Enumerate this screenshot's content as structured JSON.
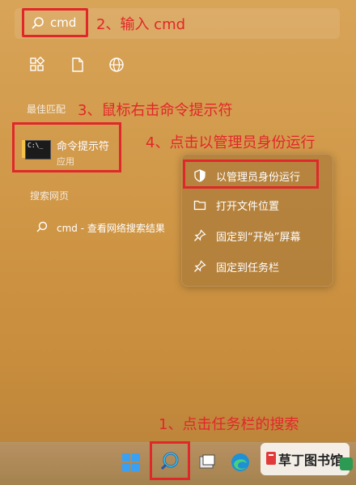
{
  "search": {
    "query": "cmd"
  },
  "annotations": {
    "step1": "1、点击任务栏的搜索",
    "step2": "2、输入 cmd",
    "step3": "3、鼠标右击命令提示符",
    "step4": "4、点击以管理员身份运行"
  },
  "sections": {
    "best_match": "最佳匹配",
    "web_search": "搜索网页"
  },
  "best_match": {
    "name": "命令提示符",
    "type": "应用"
  },
  "web_result": {
    "text": "cmd - 查看网络搜索结果"
  },
  "context_menu": {
    "items": [
      {
        "label": "以管理员身份运行",
        "icon": "shield-icon"
      },
      {
        "label": "打开文件位置",
        "icon": "folder-icon"
      },
      {
        "label": "固定到“开始”屏幕",
        "icon": "pin-icon"
      },
      {
        "label": "固定到任务栏",
        "icon": "pin-icon"
      }
    ]
  },
  "watermark": {
    "text": "草丁图书馆"
  },
  "colors": {
    "annotation": "#e0282b",
    "background": "#d09848"
  }
}
